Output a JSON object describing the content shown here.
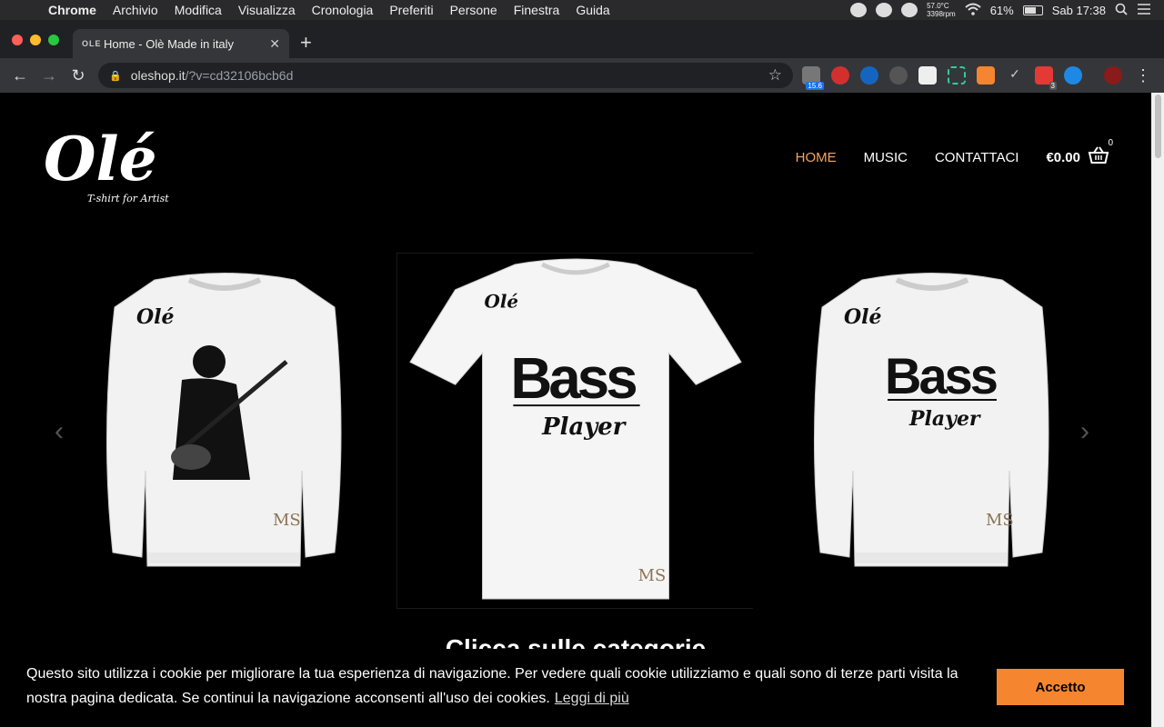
{
  "menubar": {
    "app": "Chrome",
    "items": [
      "Archivio",
      "Modifica",
      "Visualizza",
      "Cronologia",
      "Preferiti",
      "Persone",
      "Finestra",
      "Guida"
    ],
    "temp": "57.0°C",
    "rpm": "3398rpm",
    "battery": "61%",
    "clock": "Sab 17:38"
  },
  "tab": {
    "favicon_text": "OLE",
    "title": "Home - Olè Made in italy"
  },
  "address": {
    "host": "oleshop.it",
    "path": "/?v=cd32106bcb6d"
  },
  "extensions": {
    "badge1": "15.6",
    "badge2": "3"
  },
  "site": {
    "logo_text": "Olé",
    "logo_tagline": "T-shirt for Artist",
    "nav": [
      "HOME",
      "MUSIC",
      "CONTATTACI"
    ],
    "cart_total": "€0.00",
    "cart_count": "0"
  },
  "carousel": {
    "slide1": {
      "brand": "Olé",
      "mark": "MS"
    },
    "slide2": {
      "line1": "Bass",
      "line2": "Player",
      "brand": "Olé",
      "mark": "MS"
    },
    "slide3": {
      "line1": "Bass",
      "line2": "Player",
      "brand": "Olé",
      "mark": "MS"
    }
  },
  "heading": "Clicca sulle categorie",
  "cookie": {
    "message": "Questo sito utilizza i cookie per migliorare la tua esperienza di navigazione. Per vedere quali cookie utilizziamo e quali sono di terze parti visita la nostra pagina dedicata. Se continui la navigazione acconsenti all'uso dei cookies.",
    "link": "Leggi di più",
    "button": "Accetto"
  },
  "colors": {
    "accent": "#f5862f",
    "nav_active": "#f4a460"
  }
}
